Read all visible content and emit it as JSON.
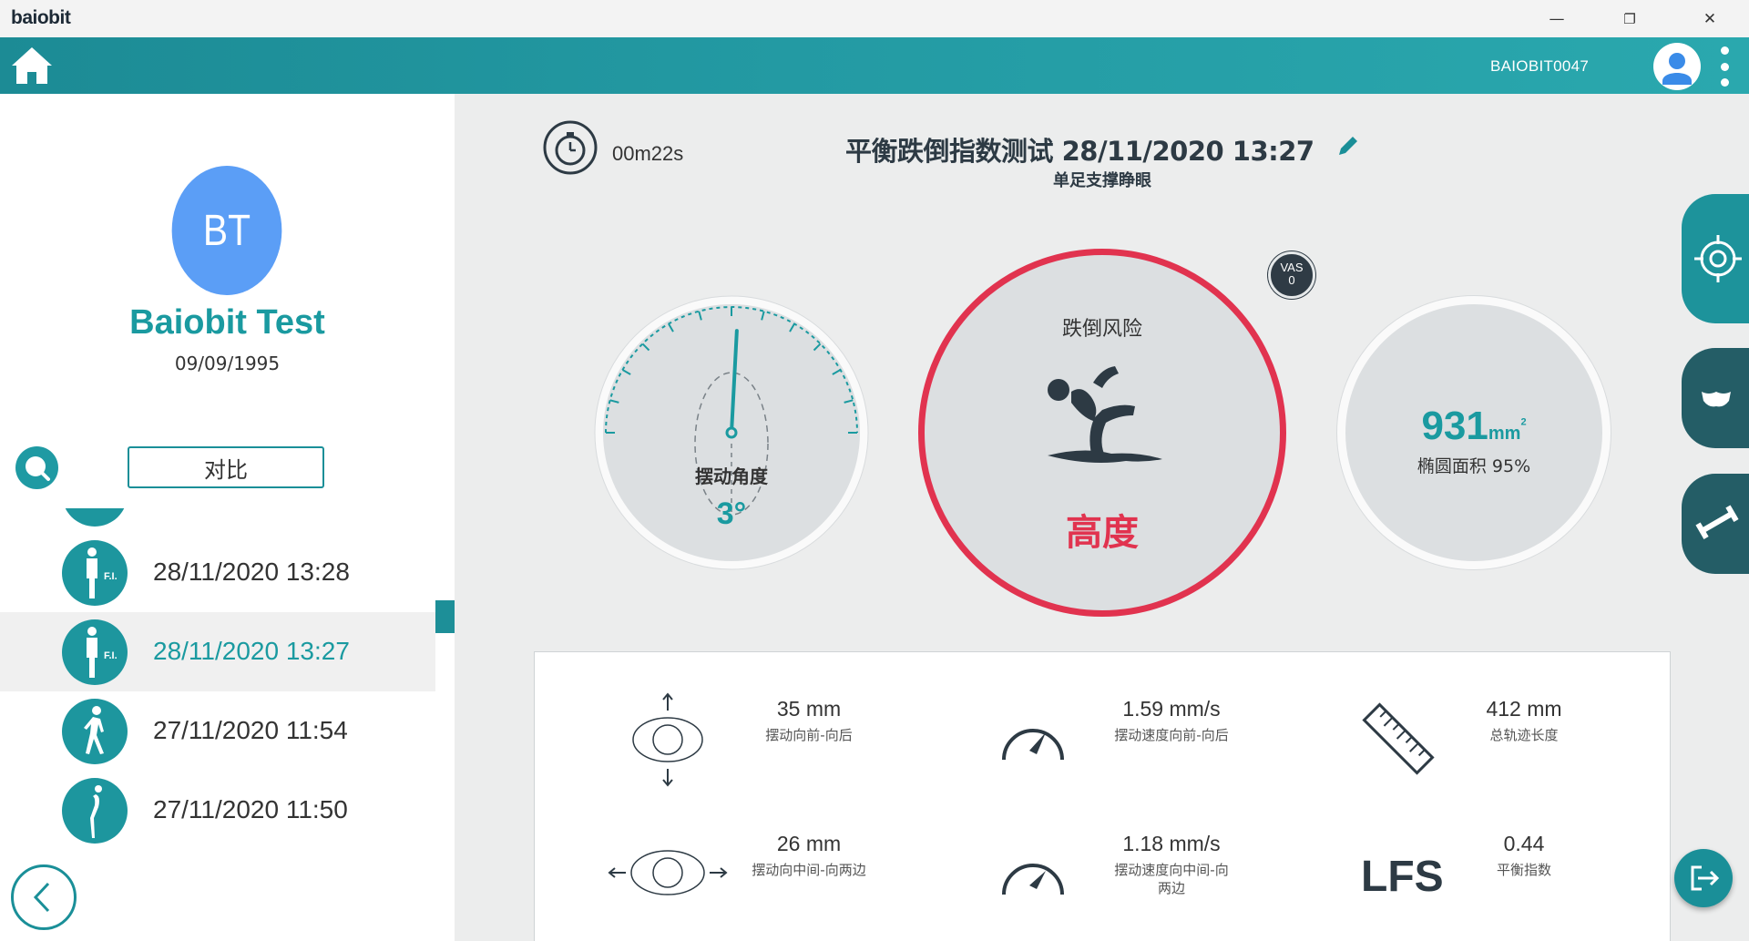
{
  "window": {
    "brand": "baiobit",
    "minimize": "—",
    "restore": "❐",
    "close": "✕"
  },
  "header": {
    "device": "BAIOBIT0047"
  },
  "patient": {
    "initials": "BT",
    "name": "Baiobit Test",
    "dob": "09/09/1995"
  },
  "sidebar": {
    "compare_label": "对比",
    "tests": [
      {
        "date": "28/11/2020 13:28",
        "icon": "standing-fi-icon",
        "selected": false
      },
      {
        "date": "28/11/2020 13:27",
        "icon": "standing-fi-icon",
        "selected": true
      },
      {
        "date": "27/11/2020 11:54",
        "icon": "walking-icon",
        "selected": false
      },
      {
        "date": "27/11/2020 11:50",
        "icon": "bending-icon",
        "selected": false
      }
    ]
  },
  "test": {
    "duration": "00m22s",
    "title": "平衡跌倒指数测试 28/11/2020 13:27",
    "subtitle": "单足支撑睁眼"
  },
  "sway": {
    "label": "摆动角度",
    "value": "3°",
    "angle_deg": 3
  },
  "risk": {
    "label": "跌倒风险",
    "level": "高度",
    "color": "#e1334f"
  },
  "vas": {
    "label": "VAS",
    "value": "0"
  },
  "area": {
    "value": "931",
    "unit": "mm",
    "unit_sup": "2",
    "label": "椭圆面积 95%"
  },
  "metrics": {
    "ap_sway": {
      "value": "35 mm",
      "label": "摆动向前-向后"
    },
    "ap_speed": {
      "value": "1.59 mm/s",
      "label": "摆动速度向前-向后"
    },
    "path_length": {
      "value": "412 mm",
      "label": "总轨迹长度"
    },
    "ml_sway": {
      "value": "26 mm",
      "label": "摆动向中间-向两边"
    },
    "ml_speed": {
      "value": "1.18 mm/s",
      "label_line1": "摆动速度向中间-向",
      "label_line2": "两边"
    },
    "lfs": {
      "abbr": "LFS",
      "value": "0.44",
      "label": "平衡指数"
    }
  },
  "colors": {
    "teal": "#1d939b",
    "red": "#e1334f",
    "avatar": "#5b9ef6"
  }
}
